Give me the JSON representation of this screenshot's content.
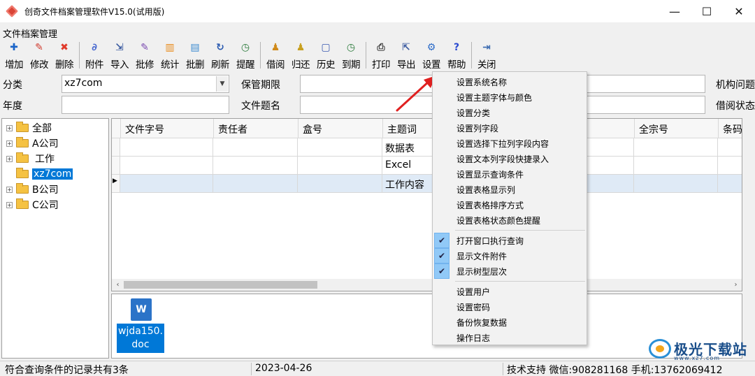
{
  "window": {
    "title": "创奇文件档案管理软件V15.0(试用版)",
    "minimize": "—",
    "maximize": "☐",
    "close": "✕"
  },
  "menu": {
    "label": "文件档案管理"
  },
  "toolbar": {
    "groups": [
      [
        {
          "label": "增加",
          "icon": "plus-icon",
          "glyph": "✚",
          "color": "#1a64c8"
        },
        {
          "label": "修改",
          "icon": "pencil-icon",
          "glyph": "✎",
          "color": "#d03a2e"
        },
        {
          "label": "删除",
          "icon": "delete-x-icon",
          "glyph": "✖",
          "color": "#e03a2a"
        }
      ],
      [
        {
          "label": "附件",
          "icon": "paperclip-icon",
          "glyph": "∂",
          "color": "#4a6ad0"
        },
        {
          "label": "导入",
          "icon": "import-icon",
          "glyph": "⇲",
          "color": "#3a5aa0"
        },
        {
          "label": "批修",
          "icon": "batch-edit-icon",
          "glyph": "✎",
          "color": "#7a4ab0"
        },
        {
          "label": "统计",
          "icon": "statistics-icon",
          "glyph": "▥",
          "color": "#e88a1a"
        },
        {
          "label": "批删",
          "icon": "batch-delete-icon",
          "glyph": "▤",
          "color": "#3a8ad0"
        },
        {
          "label": "刷新",
          "icon": "refresh-icon",
          "glyph": "↻",
          "color": "#2a5ab0"
        },
        {
          "label": "提醒",
          "icon": "clock-icon",
          "glyph": "◷",
          "color": "#2a7a3a"
        }
      ],
      [
        {
          "label": "借阅",
          "icon": "borrow-icon",
          "glyph": "♟",
          "color": "#d08a1a"
        },
        {
          "label": "归还",
          "icon": "return-icon",
          "glyph": "♟",
          "color": "#c8a020"
        },
        {
          "label": "历史",
          "icon": "history-icon",
          "glyph": "▢",
          "color": "#3a5ab0"
        },
        {
          "label": "到期",
          "icon": "due-clock-icon",
          "glyph": "◷",
          "color": "#2a7a3a"
        }
      ],
      [
        {
          "label": "打印",
          "icon": "printer-icon",
          "glyph": "⎙",
          "color": "#444444"
        },
        {
          "label": "导出",
          "icon": "export-icon",
          "glyph": "⇱",
          "color": "#3a5aa0"
        },
        {
          "label": "设置",
          "icon": "gear-icon",
          "glyph": "⚙",
          "color": "#2a6ac8"
        },
        {
          "label": "帮助",
          "icon": "help-icon",
          "glyph": "?",
          "color": "#2a4ad0"
        }
      ],
      [
        {
          "label": "关闭",
          "icon": "exit-icon",
          "glyph": "⇥",
          "color": "#3a6ab0"
        }
      ]
    ]
  },
  "filters": {
    "category_label": "分类",
    "category_value": "xz7com",
    "period_label": "保管期限",
    "period_value": "",
    "org_label": "机构问题",
    "year_label": "年度",
    "year_value": "",
    "title_label": "文件题名",
    "title_value": "",
    "borrow_label": "借阅状态"
  },
  "tree": {
    "items": [
      {
        "label": "全部",
        "expander": "+",
        "selected": false
      },
      {
        "label": "A公司",
        "expander": "+",
        "selected": false
      },
      {
        "label": "工作",
        "expander": "+",
        "selected": false
      },
      {
        "label": "xz7com",
        "expander": "",
        "selected": true
      },
      {
        "label": "B公司",
        "expander": "+",
        "selected": false
      },
      {
        "label": "C公司",
        "expander": "+",
        "selected": false
      }
    ]
  },
  "grid": {
    "columns": [
      "文件字号",
      "责任者",
      "盒号",
      "主题词",
      "",
      "",
      "全宗号",
      "条码编号"
    ],
    "rows": [
      [
        "",
        "",
        "",
        "数据表",
        "",
        "",
        "",
        ""
      ],
      [
        "",
        "",
        "",
        "Excel",
        "",
        "",
        "",
        ""
      ],
      [
        "",
        "",
        "",
        "工作内容",
        "",
        "",
        "",
        ""
      ]
    ],
    "row_pointer": "▶",
    "scroll_left": "‹",
    "scroll_right": "›"
  },
  "attachment": {
    "name_line1": "wjda150.",
    "name_line2": "doc",
    "icon_letter": "W"
  },
  "context_menu": {
    "group1": [
      "设置系统名称",
      "设置主题字体与颜色",
      "设置分类",
      "设置列字段",
      "设置选择下拉列字段内容",
      "设置文本列字段快捷录入",
      "设置显示查询条件",
      "设置表格显示列",
      "设置表格排序方式",
      "设置表格状态颜色提醒"
    ],
    "group2": [
      "打开窗口执行查询",
      "显示文件附件",
      "显示树型层次"
    ],
    "group3": [
      "设置用户",
      "设置密码",
      "备份恢复数据",
      "操作日志"
    ],
    "check_glyph": "✔"
  },
  "status": {
    "records": "符合查询条件的记录共有3条",
    "date": "2023-04-26",
    "support": "技术支持 微信:908281168 手机:13762069412"
  },
  "watermark": {
    "text": "极光下载站",
    "sub": "www.xz7.com"
  },
  "colors": {
    "selection": "#0078d7",
    "arrow": "#e02020"
  }
}
